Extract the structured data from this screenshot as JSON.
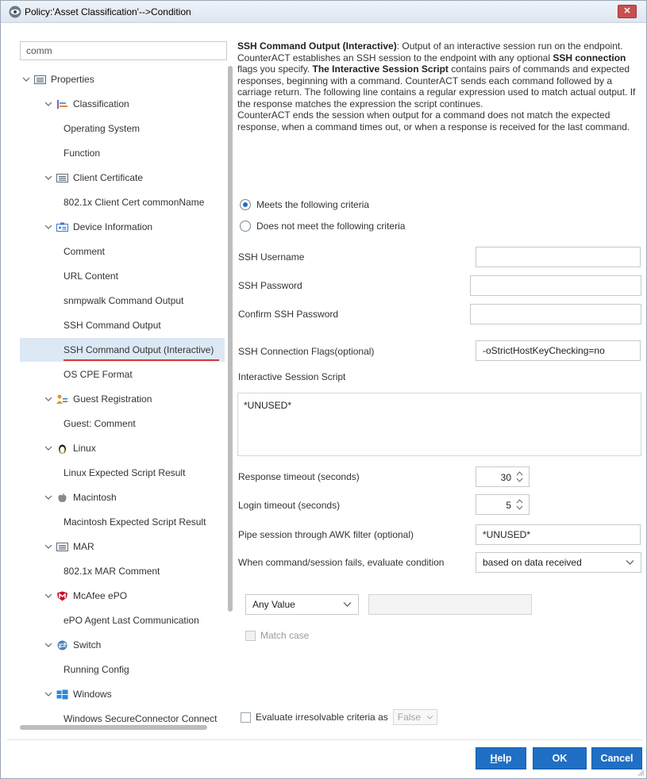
{
  "window": {
    "title": "Policy:'Asset Classification'-->Condition",
    "close_label": "✕"
  },
  "search": {
    "value": "comm"
  },
  "tree": {
    "items": [
      {
        "label": "Properties",
        "level": 0,
        "icon": "list-icon"
      },
      {
        "label": "Classification",
        "level": 1,
        "icon": "classification-icon"
      },
      {
        "label": "Operating System",
        "level": 2
      },
      {
        "label": "Function",
        "level": 2
      },
      {
        "label": "Client Certificate",
        "level": 1,
        "icon": "list-icon"
      },
      {
        "label": "802.1x Client Cert commonName",
        "level": 2
      },
      {
        "label": "Device Information",
        "level": 1,
        "icon": "device-info-icon"
      },
      {
        "label": "Comment",
        "level": 2
      },
      {
        "label": "URL Content",
        "level": 2
      },
      {
        "label": "snmpwalk Command Output",
        "level": 2
      },
      {
        "label": "SSH Command Output",
        "level": 2
      },
      {
        "label": "SSH Command Output (Interactive)",
        "level": 2,
        "selected": true
      },
      {
        "label": "OS CPE Format",
        "level": 2
      },
      {
        "label": "Guest Registration",
        "level": 1,
        "icon": "guest-icon"
      },
      {
        "label": "Guest: Comment",
        "level": 2
      },
      {
        "label": "Linux",
        "level": 1,
        "icon": "linux-icon"
      },
      {
        "label": "Linux Expected Script Result",
        "level": 2
      },
      {
        "label": "Macintosh",
        "level": 1,
        "icon": "apple-icon"
      },
      {
        "label": "Macintosh Expected Script Result",
        "level": 2
      },
      {
        "label": "MAR",
        "level": 1,
        "icon": "list-icon"
      },
      {
        "label": "802.1x MAR Comment",
        "level": 2
      },
      {
        "label": "McAfee ePO",
        "level": 1,
        "icon": "mcafee-icon"
      },
      {
        "label": "ePO Agent Last Communication",
        "level": 2
      },
      {
        "label": "Switch",
        "level": 1,
        "icon": "switch-icon"
      },
      {
        "label": "Running Config",
        "level": 2
      },
      {
        "label": "Windows",
        "level": 1,
        "icon": "windows-icon"
      },
      {
        "label": "Windows SecureConnector Connect",
        "level": 2
      }
    ]
  },
  "description": {
    "heading": "SSH Command Output (Interactive)",
    "intro": ": Output of an interactive session run on the endpoint.",
    "p1_a": "CounterACT establishes an SSH session to the endpoint with any optional ",
    "p1_b": "SSH connection",
    "p1_c": " flags you specify. ",
    "p1_d": "The Interactive Session Script",
    "p1_e": " contains pairs of commands and expected responses, beginning with a command. CounterACT sends each command followed by a carriage return. The following line contains a regular expression used to match actual output. If the response matches the expression the script continues.",
    "p2": "CounterACT ends the session when output for a command does not match the expected response, when a command times out, or when a response is received for the last command."
  },
  "criteria": {
    "meets": "Meets the following criteria",
    "not_meets": "Does not meet the following criteria",
    "selected": "meets"
  },
  "form": {
    "ssh_username_label": "SSH Username",
    "ssh_username_value": "",
    "ssh_password_label": "SSH Password",
    "ssh_password_value": "",
    "confirm_password_label": "Confirm SSH Password",
    "confirm_password_value": "",
    "flags_label": "SSH Connection Flags(optional)",
    "flags_value": "-oStrictHostKeyChecking=no",
    "script_label": "Interactive Session Script",
    "script_value": "*UNUSED*",
    "response_timeout_label": "Response  timeout (seconds)",
    "response_timeout_value": "30",
    "login_timeout_label": "Login  timeout (seconds)",
    "login_timeout_value": "5",
    "awk_label": "Pipe session through AWK filter (optional)",
    "awk_value": "*UNUSED*",
    "fail_label": "When command/session fails, evaluate condition",
    "fail_value": "based on data received",
    "match_type_value": "Any Value",
    "match_value": "",
    "match_case_label": "Match case",
    "evaluate_label": "Evaluate irresolvable criteria as",
    "evaluate_value": "False"
  },
  "buttons": {
    "help_first": "H",
    "help_rest": "elp",
    "ok": "OK",
    "cancel": "Cancel"
  },
  "colors": {
    "accent": "#1f6fc5",
    "selection_bg": "#dce9f5",
    "selection_underline": "#d9363e",
    "close": "#c75050"
  }
}
